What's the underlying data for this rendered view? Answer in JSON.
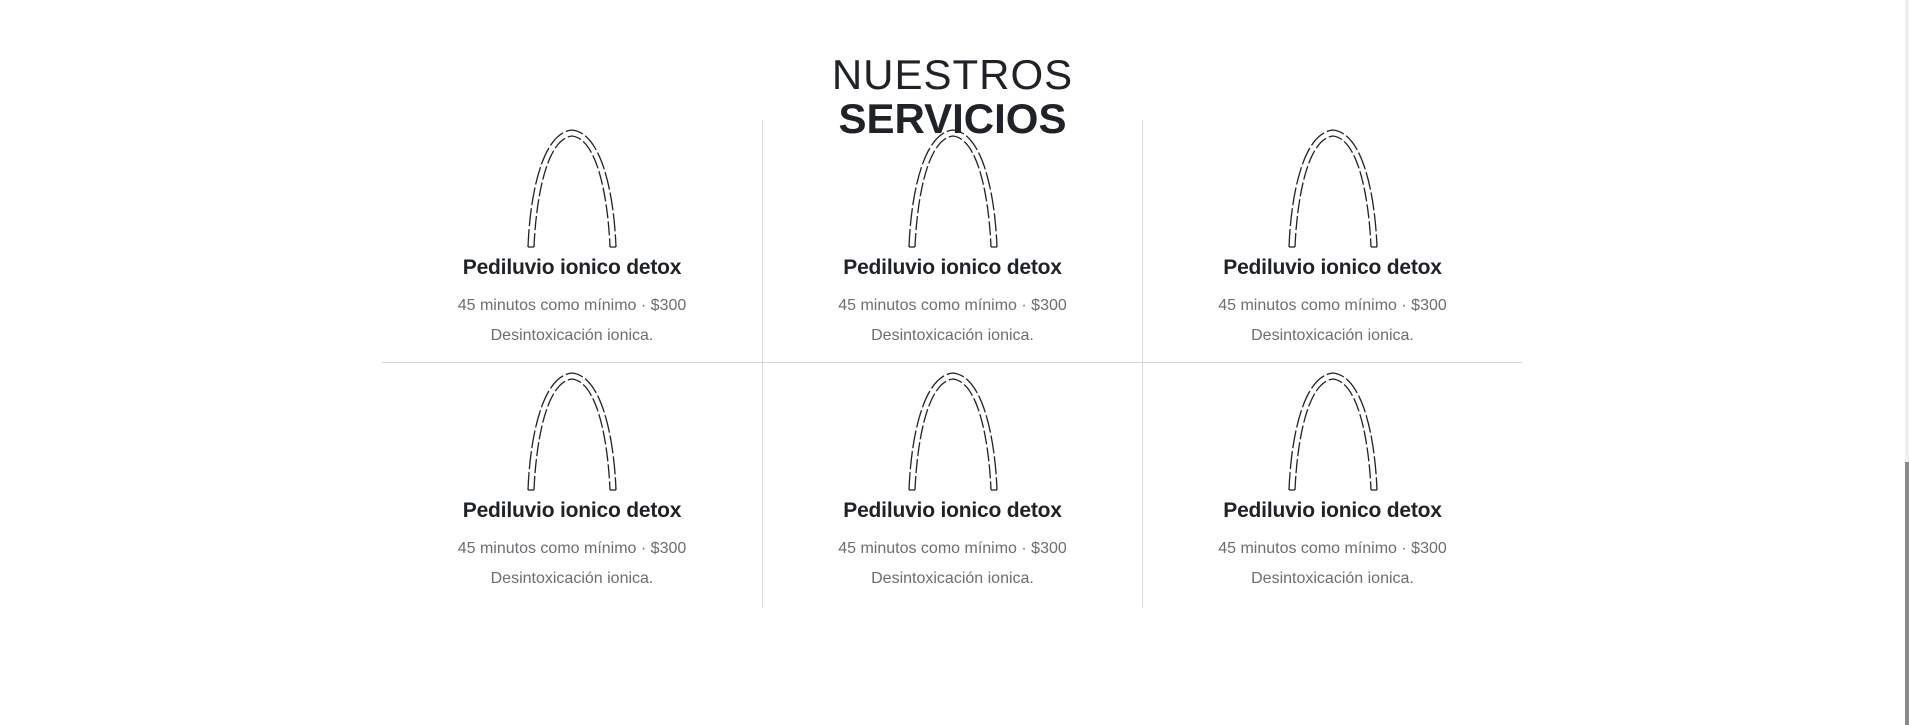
{
  "heading": {
    "line1": "NUESTROS",
    "line2": "SERVICIOS"
  },
  "services": [
    {
      "icon": "arch-icon",
      "title": "Pediluvio ionico detox",
      "meta": "45 minutos como mínimo · $300",
      "description": "Desintoxicación ionica."
    },
    {
      "icon": "arch-icon",
      "title": "Pediluvio ionico detox",
      "meta": "45 minutos como mínimo · $300",
      "description": "Desintoxicación ionica."
    },
    {
      "icon": "arch-icon",
      "title": "Pediluvio ionico detox",
      "meta": "45 minutos como mínimo · $300",
      "description": "Desintoxicación ionica."
    },
    {
      "icon": "arch-icon",
      "title": "Pediluvio ionico detox",
      "meta": "45 minutos como mínimo · $300",
      "description": "Desintoxicación ionica."
    },
    {
      "icon": "arch-icon",
      "title": "Pediluvio ionico detox",
      "meta": "45 minutos como mínimo · $300",
      "description": "Desintoxicación ionica."
    },
    {
      "icon": "arch-icon",
      "title": "Pediluvio ionico detox",
      "meta": "45 minutos como mínimo · $300",
      "description": "Desintoxicación ionica."
    }
  ],
  "colors": {
    "text_dark": "#1f2327",
    "text_muted": "#6b6f73",
    "divider": "#d6d6d6"
  }
}
